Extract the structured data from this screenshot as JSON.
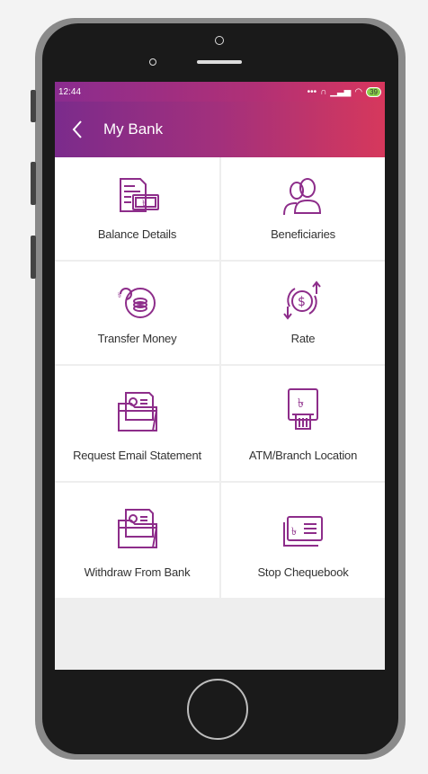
{
  "status_bar": {
    "time": "12:44",
    "battery": "39"
  },
  "header": {
    "title": "My Bank"
  },
  "tiles": [
    {
      "label": "Balance Details",
      "icon": "balance-details-icon"
    },
    {
      "label": "Beneficiaries",
      "icon": "beneficiaries-icon"
    },
    {
      "label": "Transfer Money",
      "icon": "transfer-money-icon"
    },
    {
      "label": "Rate",
      "icon": "rate-icon"
    },
    {
      "label": "Request Email Statement",
      "icon": "email-statement-icon"
    },
    {
      "label": "ATM/Branch Location",
      "icon": "atm-icon"
    },
    {
      "label": "Withdraw From Bank",
      "icon": "withdraw-icon"
    },
    {
      "label": "Stop Chequebook",
      "icon": "chequebook-icon"
    }
  ],
  "colors": {
    "accent": "#8a2c8f",
    "gradient_end": "#d8365d",
    "icon": "#8d2d8a"
  }
}
